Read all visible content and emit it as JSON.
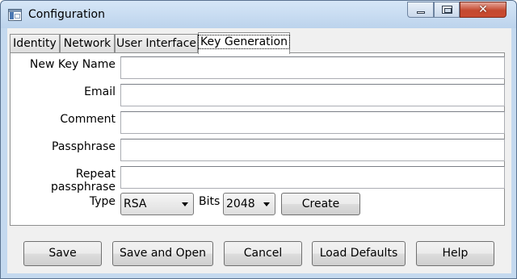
{
  "window": {
    "title": "Configuration",
    "close_glyph": "✕"
  },
  "tabs": [
    {
      "label": "Identity"
    },
    {
      "label": "Network"
    },
    {
      "label": "User Interface"
    },
    {
      "label": "Key Generation"
    }
  ],
  "active_tab": "Key Generation",
  "form": {
    "new_key_name": {
      "label": "New Key Name",
      "value": ""
    },
    "email": {
      "label": "Email",
      "value": ""
    },
    "comment": {
      "label": "Comment",
      "value": ""
    },
    "passphrase": {
      "label": "Passphrase",
      "value": ""
    },
    "repeat_passphrase": {
      "label": "Repeat passphrase",
      "value": ""
    },
    "type": {
      "label": "Type",
      "value": "RSA"
    },
    "bits": {
      "label": "Bits",
      "value": "2048"
    },
    "create_label": "Create"
  },
  "buttons": {
    "save": "Save",
    "save_and_open": "Save and Open",
    "cancel": "Cancel",
    "load_defaults": "Load Defaults",
    "help": "Help"
  },
  "icons": {
    "app": "window-app-icon",
    "minimize": "minimize-icon",
    "maximize": "maximize-icon",
    "close": "close-icon",
    "dropdown": "chevron-down-icon"
  }
}
